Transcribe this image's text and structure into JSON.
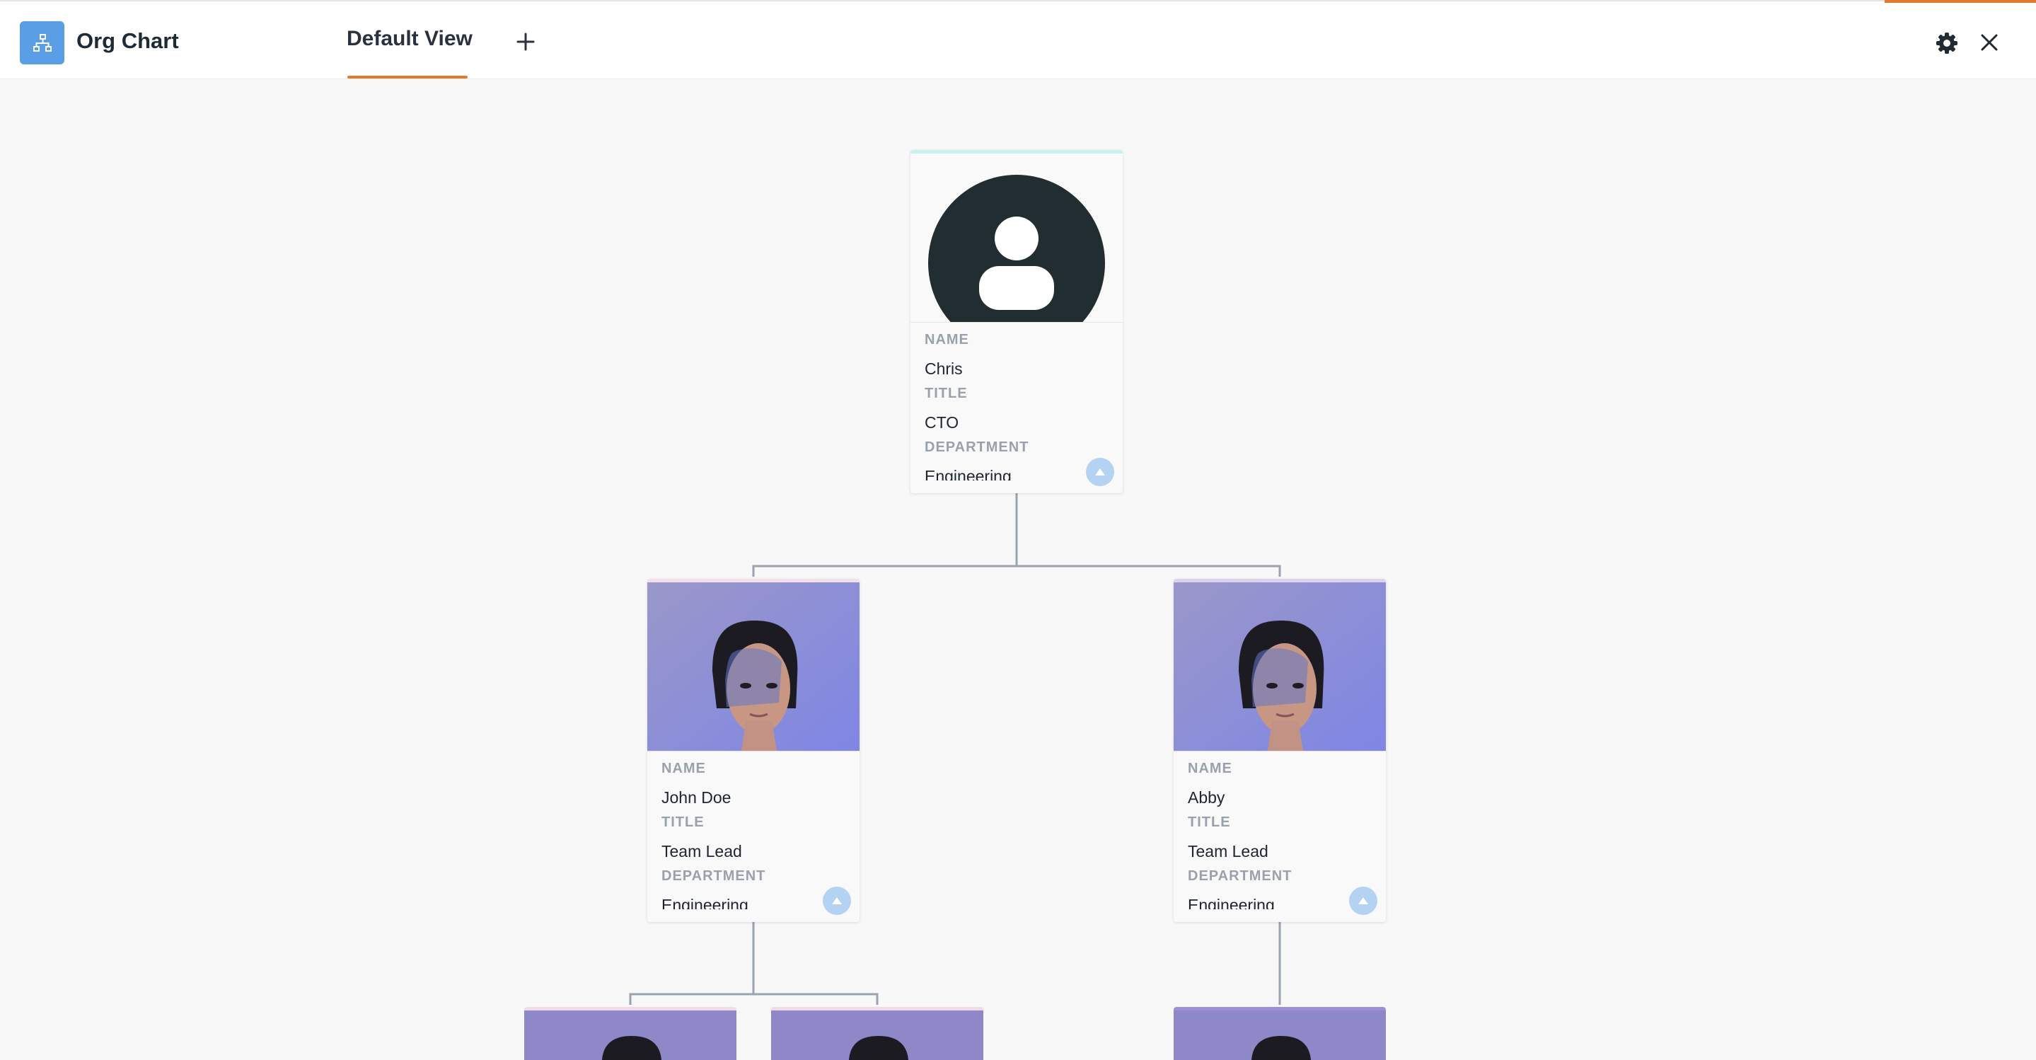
{
  "app": {
    "title": "Org Chart",
    "icon": "org-chart-icon",
    "accent": "#5a9fe6"
  },
  "tabs": [
    {
      "label": "Default View",
      "active": true
    }
  ],
  "toolbar": {
    "add_tab_icon": "plus-icon",
    "settings_icon": "gear-icon",
    "close_icon": "close-icon"
  },
  "labels": {
    "name": "NAME",
    "title": "TITLE",
    "department": "DEPARTMENT"
  },
  "employees": [
    {
      "name": "Chris",
      "title": "CTO",
      "department": "Engineering",
      "photo": "default-avatar",
      "accent": "#c9f1ee"
    },
    {
      "name": "John Doe",
      "title": "Team Lead",
      "department": "Engineering",
      "photo": "person-photo",
      "accent": "#f3dfe9"
    },
    {
      "name": "Abby",
      "title": "Team Lead",
      "department": "Engineering",
      "photo": "person-photo",
      "accent": "#ddd2ee"
    }
  ],
  "colors": {
    "tab_underline": "#e07a2f",
    "connector": "#9aa3af",
    "expand_button": "#b4d2f2"
  }
}
